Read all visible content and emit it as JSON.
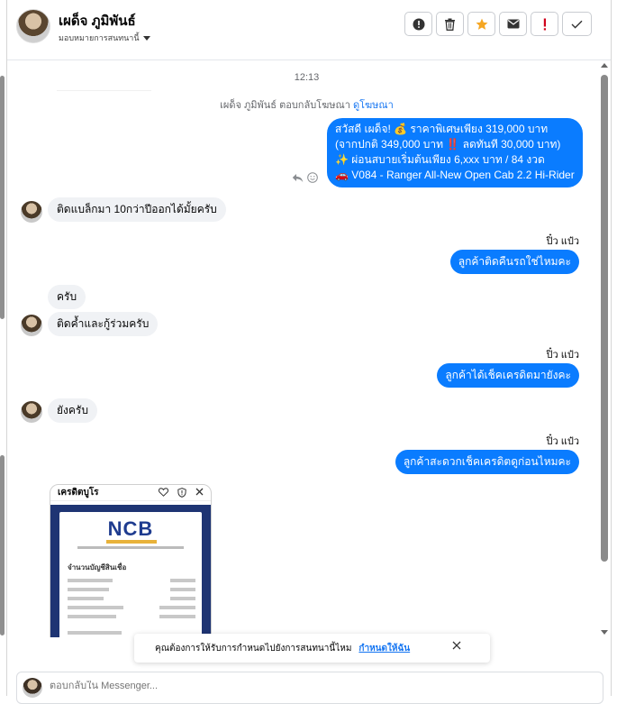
{
  "header": {
    "name": "เผด็จ ภูมิพันธ์",
    "assign_label": "มอบหมายการสนทนานี้"
  },
  "toolbar": {
    "buttons": [
      "info-circle",
      "trash",
      "star",
      "mail",
      "exclamation",
      "check"
    ],
    "accent": "#d0021b",
    "star_color": "#f5a623"
  },
  "conversation": {
    "time": "12:13",
    "reply_note_prefix": "เผด็จ ภูมิพันธ์ ตอบกลับโฆษณา",
    "reply_note_link": "ดูโฆษณา",
    "ad_message": {
      "line1": "สวัสดี เผด็จ! 💰 ราคาพิเศษเพียง 319,000 บาท",
      "line2": "(จากปกติ 349,000 บาท ‼️ ลดทันที 30,000 บาท)",
      "line3": "✨ ผ่อนสบายเริ่มต้นเพียง 6,xxx บาท / 84 งวด",
      "line4": "🚗 V084 - Ranger All-New Open Cab 2.2 Hi-Rider"
    },
    "messages": [
      {
        "side": "in",
        "text": "ติดแบล็กมา 10กว่าปีออกได้มั้ยครับ"
      },
      {
        "side": "out",
        "sender": "ปิ๋ว แป๋ว",
        "text": "ลูกค้าติดคืนรถใช่ไหมคะ"
      },
      {
        "side": "in",
        "text": "ครับ"
      },
      {
        "side": "in",
        "text": "ติดค้ำและกู้ร่วมครับ"
      },
      {
        "side": "out",
        "sender": "ปิ๋ว แป๋ว",
        "text": "ลูกค้าได้เช็คเครดิตมายังคะ"
      },
      {
        "side": "in",
        "text": "ยังครับ"
      },
      {
        "side": "out",
        "sender": "ปิ๋ว แป๋ว",
        "text": "ลูกค้าสะดวกเช็คเครดิตดูก่อนไหมคะ"
      }
    ],
    "attachment": {
      "title": "เครดิตบูโร",
      "logo": "NCB",
      "section": "จำนวนบัญชีสินเชื่อ"
    }
  },
  "banner": {
    "text": "คุณต้องการให้รับการกำหนดไปยังการสนทนานี้ไหม",
    "link": "กำหนดให้ฉัน"
  },
  "composer": {
    "placeholder": "ตอบกลับใน Messenger..."
  }
}
